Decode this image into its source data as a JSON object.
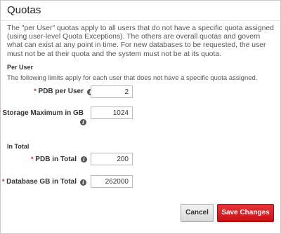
{
  "dialog": {
    "title": "Quotas",
    "description": "The \"per User\" quotas apply to all users that do not have a specific quota assigned (using user-level Quota Exceptions). The others are overall quotas and govern what can exist at any point in time. For new databases to be requested, the user must not be at their quota and the system must not be at its quota."
  },
  "per_user": {
    "heading": "Per User",
    "note": "The following limits apply for each user that does not have a specific quota assigned.",
    "fields": [
      {
        "label": "PDB per User",
        "value": "2"
      },
      {
        "label": "Storage Maximum in GB",
        "value": "1024"
      }
    ]
  },
  "in_total": {
    "heading": "In Total",
    "fields": [
      {
        "label": "PDB in Total",
        "value": "200"
      },
      {
        "label": "Database GB in Total",
        "value": "262000"
      }
    ]
  },
  "buttons": {
    "cancel": "Cancel",
    "save": "Save Changes"
  },
  "icons": {
    "required": "*",
    "info": "i"
  },
  "colors": {
    "required": "#d21f1f",
    "save_button": "#d4181d"
  }
}
